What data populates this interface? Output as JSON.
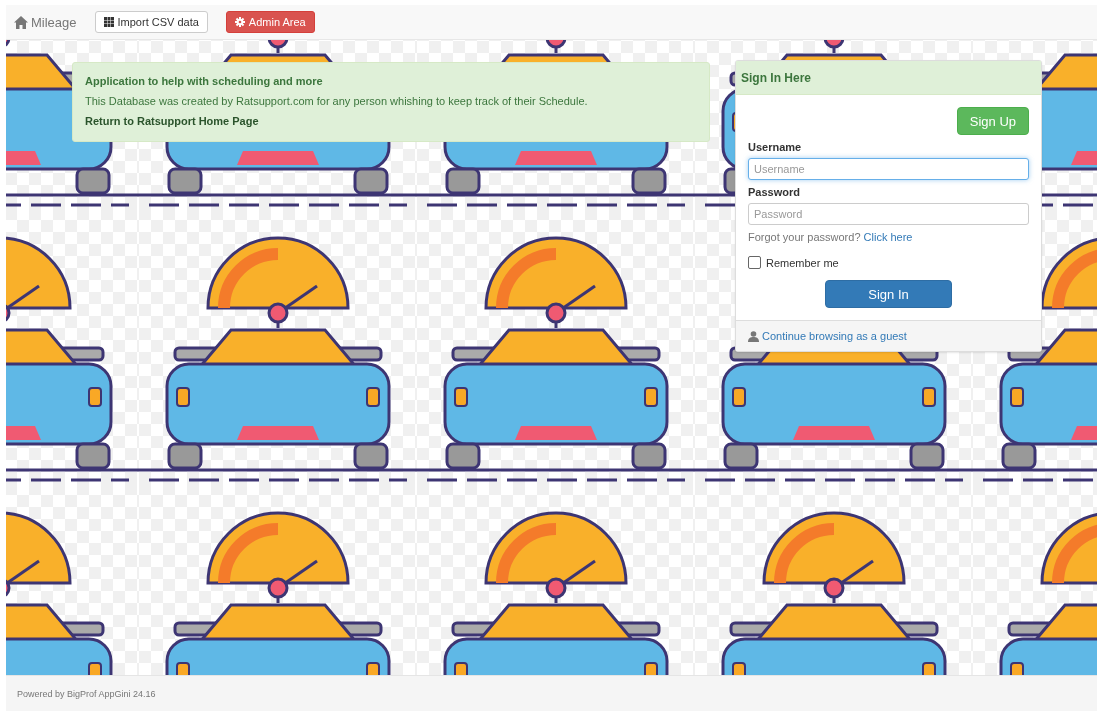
{
  "navbar": {
    "brand": "Mileage",
    "buttons": [
      {
        "label": "Import CSV data",
        "kind": "default"
      },
      {
        "label": "Admin Area",
        "kind": "danger"
      }
    ]
  },
  "info": {
    "title": "Application to help with scheduling and more",
    "text": "This Database was created by Ratsupport.com for any person whishing to keep track of their Schedule.",
    "link": "Return to Ratsupport Home Page"
  },
  "sign_in": {
    "title": "Sign In Here",
    "signup_button": "Sign Up",
    "fields": [
      {
        "label": "Username",
        "placeholder": "Username",
        "focused": true
      },
      {
        "label": "Password",
        "placeholder": "Password",
        "focused": false
      }
    ],
    "forgot_text": "Forgot your password?",
    "forgot_link": "Click here",
    "remember": {
      "label": "Remember me",
      "checked": false
    },
    "signin_button": "Sign In",
    "guest_link": "Continue browsing as a guest"
  },
  "footer": "Powered by BigProf AppGini 24.16"
}
